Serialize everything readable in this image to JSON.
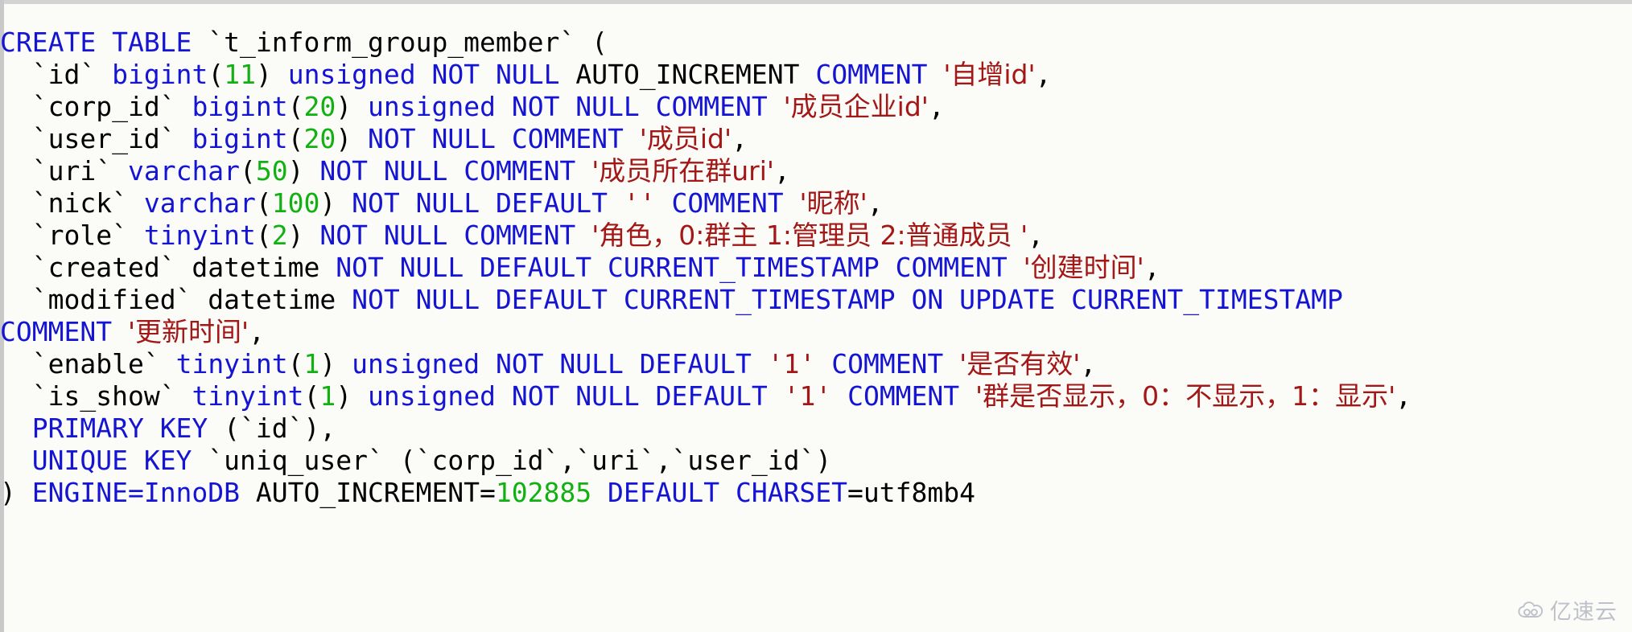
{
  "editor": {
    "language": "sql",
    "background_color": "#fbfbf8",
    "colors": {
      "keyword": "#1414d2",
      "identifier": "#000000",
      "number": "#12b012",
      "string": "#a31717",
      "punctuation": "#000000"
    }
  },
  "sql": {
    "statement_name": "CREATE TABLE `t_inform_group_member`",
    "table_name": "t_inform_group_member",
    "engine": "InnoDB",
    "auto_increment": "102885",
    "charset": "utf8mb4",
    "lines": [
      {
        "id": "line-1-create",
        "tokens": [
          {
            "t": "CREATE TABLE",
            "c": "kw"
          },
          {
            "t": " ",
            "c": "pun"
          },
          {
            "t": "`t_inform_group_member`",
            "c": "id"
          },
          {
            "t": " (",
            "c": "pun"
          }
        ]
      },
      {
        "id": "line-2-id",
        "tokens": [
          {
            "t": "  ",
            "c": "pun"
          },
          {
            "t": "`id`",
            "c": "id"
          },
          {
            "t": " ",
            "c": "pun"
          },
          {
            "t": "bigint",
            "c": "kw"
          },
          {
            "t": "(",
            "c": "pun"
          },
          {
            "t": "11",
            "c": "num"
          },
          {
            "t": ") ",
            "c": "pun"
          },
          {
            "t": "unsigned NOT NULL",
            "c": "kw"
          },
          {
            "t": " AUTO_INCREMENT ",
            "c": "id"
          },
          {
            "t": "COMMENT",
            "c": "kw"
          },
          {
            "t": " ",
            "c": "pun"
          },
          {
            "t": "'自增id'",
            "c": "str"
          },
          {
            "t": ",",
            "c": "pun"
          }
        ]
      },
      {
        "id": "line-3-corp-id",
        "tokens": [
          {
            "t": "  ",
            "c": "pun"
          },
          {
            "t": "`corp_id`",
            "c": "id"
          },
          {
            "t": " ",
            "c": "pun"
          },
          {
            "t": "bigint",
            "c": "kw"
          },
          {
            "t": "(",
            "c": "pun"
          },
          {
            "t": "20",
            "c": "num"
          },
          {
            "t": ") ",
            "c": "pun"
          },
          {
            "t": "unsigned NOT NULL COMMENT",
            "c": "kw"
          },
          {
            "t": " ",
            "c": "pun"
          },
          {
            "t": "'成员企业id'",
            "c": "str"
          },
          {
            "t": ",",
            "c": "pun"
          }
        ]
      },
      {
        "id": "line-4-user-id",
        "tokens": [
          {
            "t": "  ",
            "c": "pun"
          },
          {
            "t": "`user_id`",
            "c": "id"
          },
          {
            "t": " ",
            "c": "pun"
          },
          {
            "t": "bigint",
            "c": "kw"
          },
          {
            "t": "(",
            "c": "pun"
          },
          {
            "t": "20",
            "c": "num"
          },
          {
            "t": ") ",
            "c": "pun"
          },
          {
            "t": "NOT NULL COMMENT",
            "c": "kw"
          },
          {
            "t": " ",
            "c": "pun"
          },
          {
            "t": "'成员id'",
            "c": "str"
          },
          {
            "t": ",",
            "c": "pun"
          }
        ]
      },
      {
        "id": "line-5-uri",
        "tokens": [
          {
            "t": "  ",
            "c": "pun"
          },
          {
            "t": "`uri`",
            "c": "id"
          },
          {
            "t": " ",
            "c": "pun"
          },
          {
            "t": "varchar",
            "c": "kw"
          },
          {
            "t": "(",
            "c": "pun"
          },
          {
            "t": "50",
            "c": "num"
          },
          {
            "t": ") ",
            "c": "pun"
          },
          {
            "t": "NOT NULL COMMENT",
            "c": "kw"
          },
          {
            "t": " ",
            "c": "pun"
          },
          {
            "t": "'成员所在群uri'",
            "c": "str"
          },
          {
            "t": ",",
            "c": "pun"
          }
        ]
      },
      {
        "id": "line-6-nick",
        "tokens": [
          {
            "t": "  ",
            "c": "pun"
          },
          {
            "t": "`nick`",
            "c": "id"
          },
          {
            "t": " ",
            "c": "pun"
          },
          {
            "t": "varchar",
            "c": "kw"
          },
          {
            "t": "(",
            "c": "pun"
          },
          {
            "t": "100",
            "c": "num"
          },
          {
            "t": ") ",
            "c": "pun"
          },
          {
            "t": "NOT NULL DEFAULT",
            "c": "kw"
          },
          {
            "t": " ",
            "c": "pun"
          },
          {
            "t": "''",
            "c": "str"
          },
          {
            "t": " ",
            "c": "pun"
          },
          {
            "t": "COMMENT",
            "c": "kw"
          },
          {
            "t": " ",
            "c": "pun"
          },
          {
            "t": "'昵称'",
            "c": "str"
          },
          {
            "t": ",",
            "c": "pun"
          }
        ]
      },
      {
        "id": "line-7-role",
        "tokens": [
          {
            "t": "  ",
            "c": "pun"
          },
          {
            "t": "`role`",
            "c": "id"
          },
          {
            "t": " ",
            "c": "pun"
          },
          {
            "t": "tinyint",
            "c": "kw"
          },
          {
            "t": "(",
            "c": "pun"
          },
          {
            "t": "2",
            "c": "num"
          },
          {
            "t": ") ",
            "c": "pun"
          },
          {
            "t": "NOT NULL COMMENT",
            "c": "kw"
          },
          {
            "t": " ",
            "c": "pun"
          },
          {
            "t": "'角色，0:群主 1:管理员 2:普通成员 '",
            "c": "str"
          },
          {
            "t": ",",
            "c": "pun"
          }
        ]
      },
      {
        "id": "line-8-created",
        "tokens": [
          {
            "t": "  ",
            "c": "pun"
          },
          {
            "t": "`created`",
            "c": "id"
          },
          {
            "t": " datetime ",
            "c": "id"
          },
          {
            "t": "NOT NULL DEFAULT CURRENT_TIMESTAMP COMMENT",
            "c": "kw"
          },
          {
            "t": " ",
            "c": "pun"
          },
          {
            "t": "'创建时间'",
            "c": "str"
          },
          {
            "t": ",",
            "c": "pun"
          }
        ]
      },
      {
        "id": "line-9-modified",
        "tokens": [
          {
            "t": "  ",
            "c": "pun"
          },
          {
            "t": "`modified`",
            "c": "id"
          },
          {
            "t": " datetime ",
            "c": "id"
          },
          {
            "t": "NOT NULL DEFAULT CURRENT_TIMESTAMP ON UPDATE CURRENT_TIMESTAMP",
            "c": "kw"
          }
        ]
      },
      {
        "id": "line-10-modified-wrap",
        "tokens": [
          {
            "t": "COMMENT",
            "c": "kw"
          },
          {
            "t": " ",
            "c": "pun"
          },
          {
            "t": "'更新时间'",
            "c": "str"
          },
          {
            "t": ",",
            "c": "pun"
          }
        ]
      },
      {
        "id": "line-11-enable",
        "tokens": [
          {
            "t": "  ",
            "c": "pun"
          },
          {
            "t": "`enable`",
            "c": "id"
          },
          {
            "t": " ",
            "c": "pun"
          },
          {
            "t": "tinyint",
            "c": "kw"
          },
          {
            "t": "(",
            "c": "pun"
          },
          {
            "t": "1",
            "c": "num"
          },
          {
            "t": ") ",
            "c": "pun"
          },
          {
            "t": "unsigned NOT NULL DEFAULT",
            "c": "kw"
          },
          {
            "t": " ",
            "c": "pun"
          },
          {
            "t": "'1'",
            "c": "str"
          },
          {
            "t": " ",
            "c": "pun"
          },
          {
            "t": "COMMENT",
            "c": "kw"
          },
          {
            "t": " ",
            "c": "pun"
          },
          {
            "t": "'是否有效'",
            "c": "str"
          },
          {
            "t": ",",
            "c": "pun"
          }
        ]
      },
      {
        "id": "line-12-is-show",
        "tokens": [
          {
            "t": "  ",
            "c": "pun"
          },
          {
            "t": "`is_show`",
            "c": "id"
          },
          {
            "t": " ",
            "c": "pun"
          },
          {
            "t": "tinyint",
            "c": "kw"
          },
          {
            "t": "(",
            "c": "pun"
          },
          {
            "t": "1",
            "c": "num"
          },
          {
            "t": ") ",
            "c": "pun"
          },
          {
            "t": "unsigned NOT NULL DEFAULT",
            "c": "kw"
          },
          {
            "t": " ",
            "c": "pun"
          },
          {
            "t": "'1'",
            "c": "str"
          },
          {
            "t": " ",
            "c": "pun"
          },
          {
            "t": "COMMENT",
            "c": "kw"
          },
          {
            "t": " ",
            "c": "pun"
          },
          {
            "t": "'群是否显示，0：不显示，1：显示'",
            "c": "str"
          },
          {
            "t": ",",
            "c": "pun"
          }
        ]
      },
      {
        "id": "line-13-primary-key",
        "tokens": [
          {
            "t": "  ",
            "c": "pun"
          },
          {
            "t": "PRIMARY KEY",
            "c": "kw"
          },
          {
            "t": " (",
            "c": "pun"
          },
          {
            "t": "`id`",
            "c": "id"
          },
          {
            "t": "),",
            "c": "pun"
          }
        ]
      },
      {
        "id": "line-14-unique-key",
        "tokens": [
          {
            "t": "  ",
            "c": "pun"
          },
          {
            "t": "UNIQUE KEY",
            "c": "kw"
          },
          {
            "t": " ",
            "c": "pun"
          },
          {
            "t": "`uniq_user`",
            "c": "id"
          },
          {
            "t": " (",
            "c": "pun"
          },
          {
            "t": "`corp_id`",
            "c": "id"
          },
          {
            "t": ",",
            "c": "pun"
          },
          {
            "t": "`uri`",
            "c": "id"
          },
          {
            "t": ",",
            "c": "pun"
          },
          {
            "t": "`user_id`",
            "c": "id"
          },
          {
            "t": ")",
            "c": "pun"
          }
        ]
      },
      {
        "id": "line-15-engine",
        "tokens": [
          {
            "t": ") ",
            "c": "pun"
          },
          {
            "t": "ENGINE=InnoDB",
            "c": "kw"
          },
          {
            "t": " AUTO_INCREMENT=",
            "c": "id"
          },
          {
            "t": "102885",
            "c": "num"
          },
          {
            "t": " ",
            "c": "pun"
          },
          {
            "t": "DEFAULT CHARSET",
            "c": "kw"
          },
          {
            "t": "=utf8mb4",
            "c": "id"
          }
        ]
      }
    ]
  },
  "watermark": {
    "text": "亿速云",
    "icon": "cloud-icon",
    "color": "#8f93a6"
  }
}
